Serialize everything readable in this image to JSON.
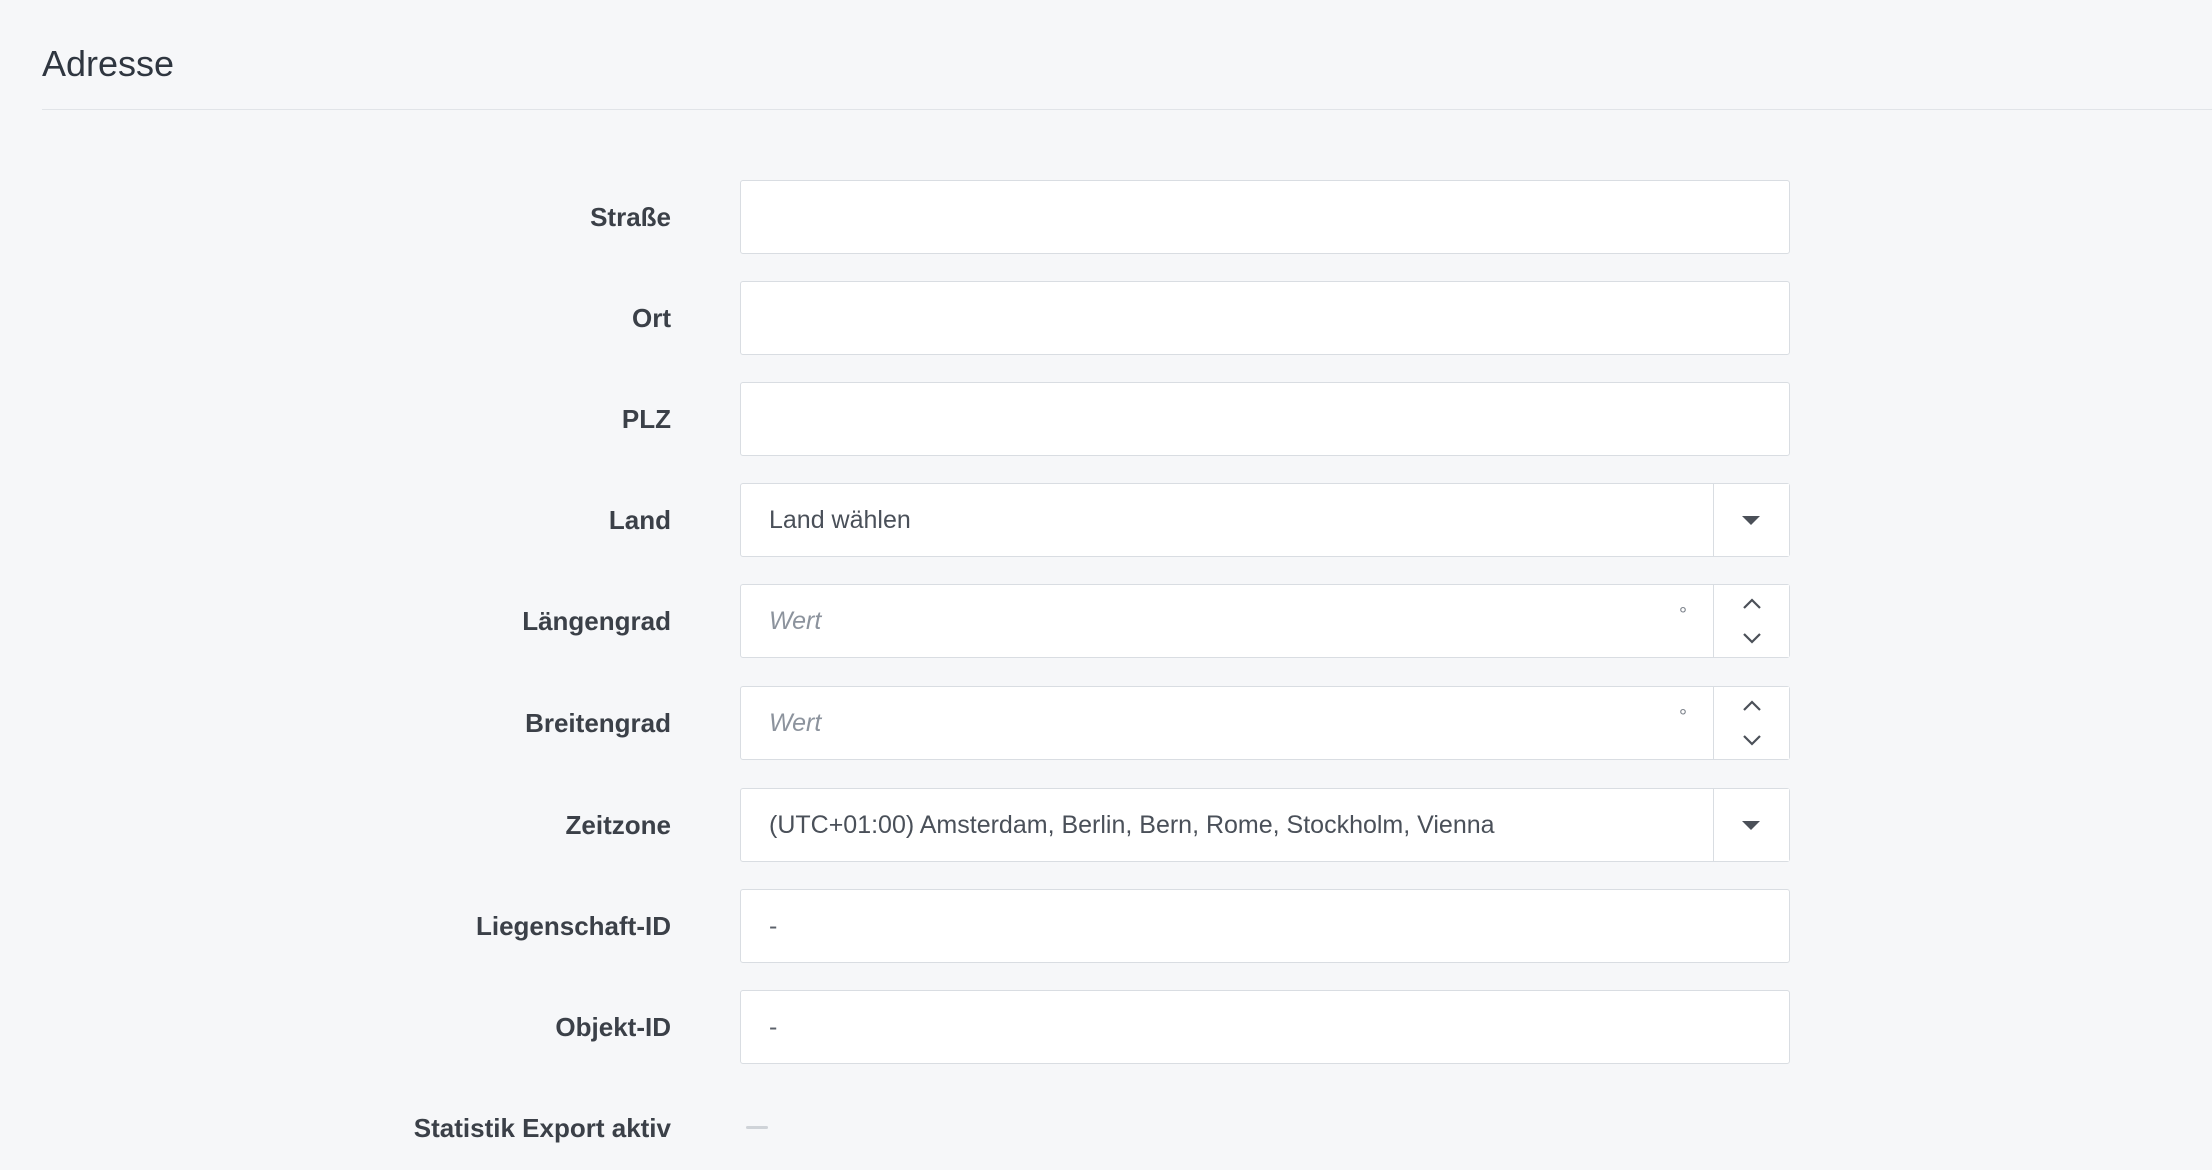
{
  "section": {
    "title": "Adresse"
  },
  "fields": {
    "street": {
      "label": "Straße",
      "value": ""
    },
    "city": {
      "label": "Ort",
      "value": ""
    },
    "zip": {
      "label": "PLZ",
      "value": ""
    },
    "country": {
      "label": "Land",
      "value": "Land wählen",
      "icon": "chevron-down-icon"
    },
    "longitude": {
      "label": "Längengrad",
      "placeholder": "Wert",
      "unit": "°"
    },
    "latitude": {
      "label": "Breitengrad",
      "placeholder": "Wert",
      "unit": "°"
    },
    "timezone": {
      "label": "Zeitzone",
      "value": "(UTC+01:00) Amsterdam, Berlin, Bern, Rome, Stockholm, Vienna"
    },
    "property_id": {
      "label": "Liegenschaft-ID",
      "value": "-"
    },
    "object_id": {
      "label": "Objekt-ID",
      "value": "-"
    },
    "statistics_export": {
      "label": "Statistik Export aktiv",
      "value": "—"
    }
  },
  "colors": {
    "background": "#f6f7f9",
    "border": "#d9dde2",
    "label": "#3b4048",
    "placeholder": "#8c939d"
  }
}
